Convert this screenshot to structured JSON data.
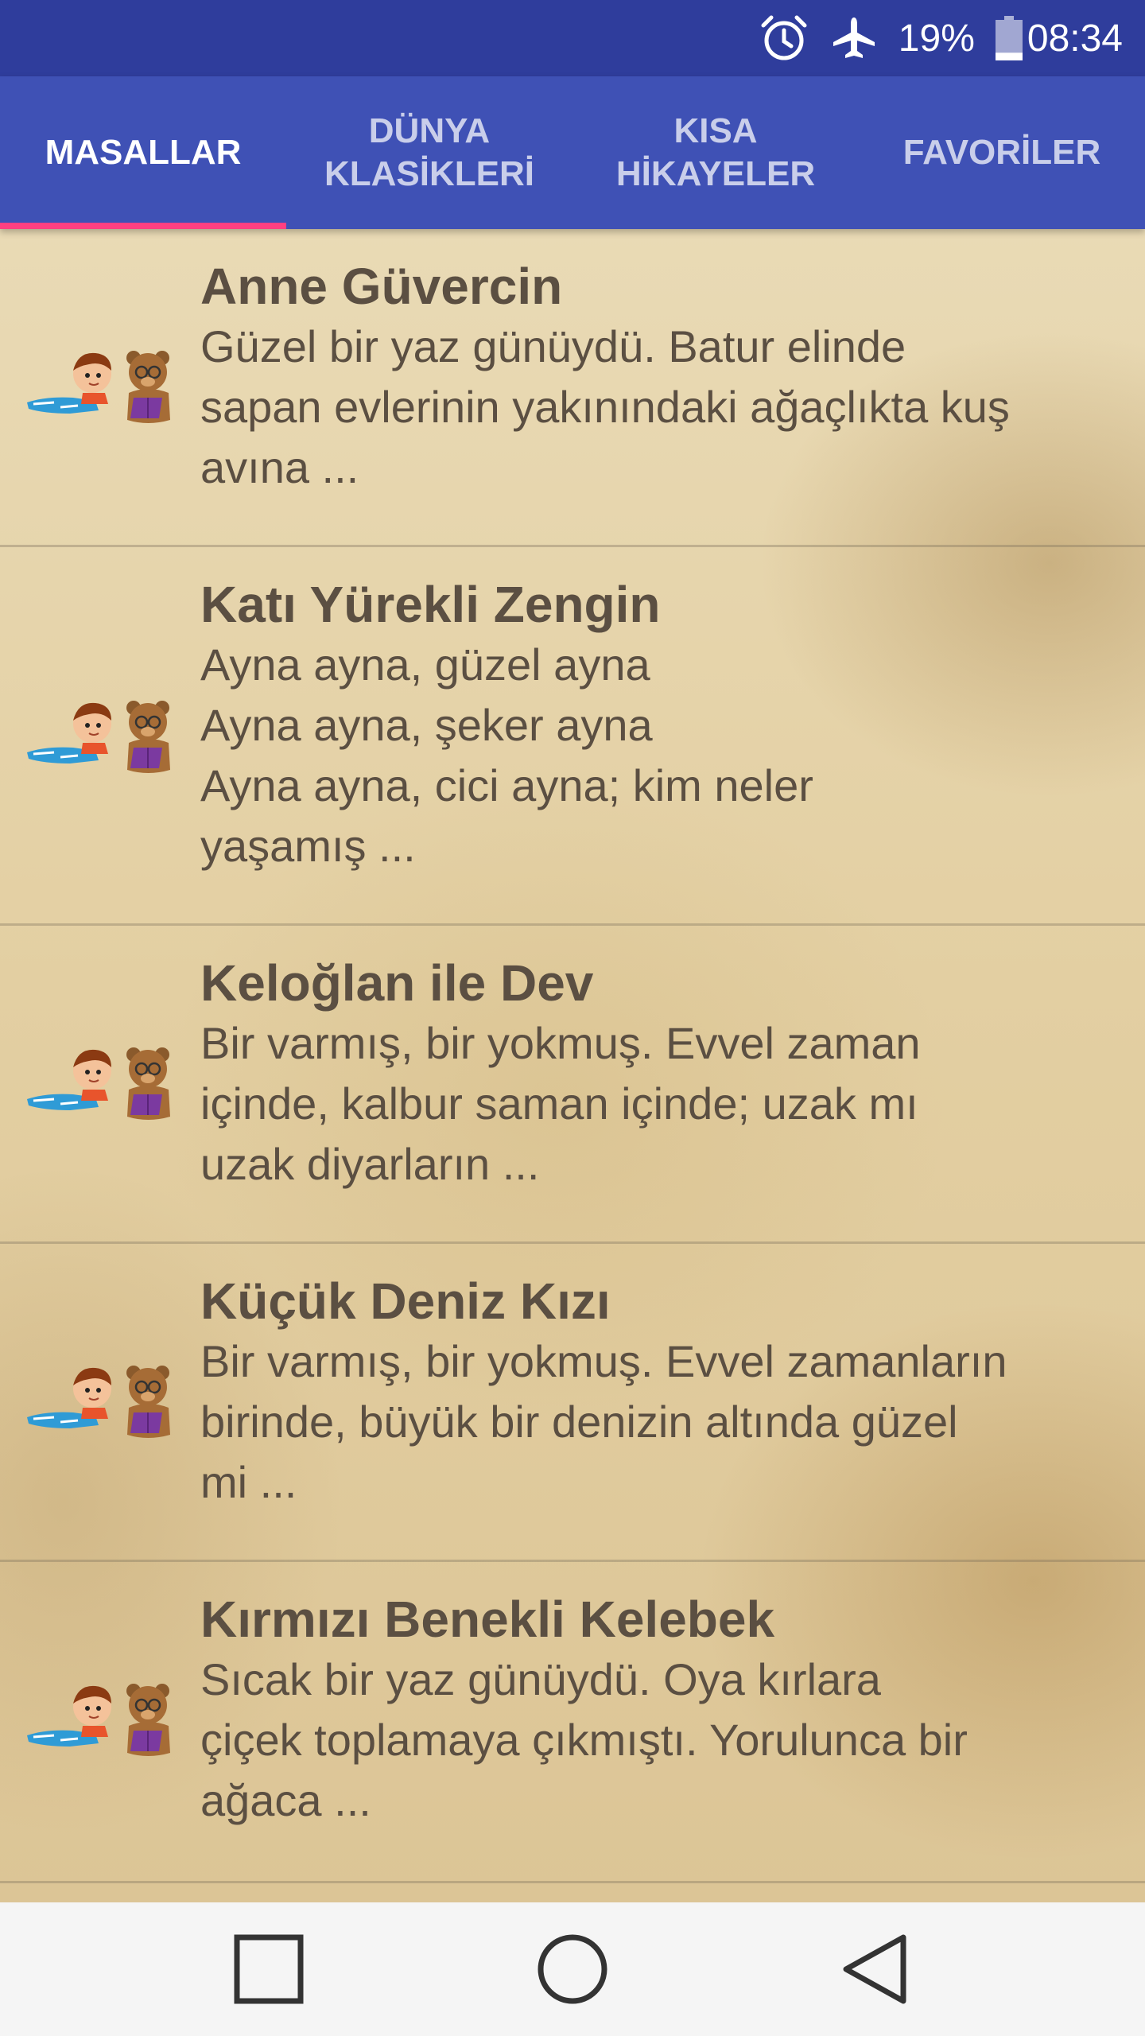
{
  "status_bar": {
    "battery": "19%",
    "time": "08:34",
    "icons": [
      "alarm-icon",
      "airplane-icon",
      "battery-icon"
    ],
    "battery_level": 0.19
  },
  "tabs": [
    {
      "label": "MASALLAR",
      "active": true
    },
    {
      "label": "DÜNYA\nKLASİKLERİ",
      "active": false
    },
    {
      "label": "KISA\nHİKAYELER",
      "active": false
    },
    {
      "label": "FAVORİLER",
      "active": false
    }
  ],
  "stories": [
    {
      "title": "Anne Güvercin",
      "excerpt": "Güzel bir yaz günüydü. Batur elinde\nsapan evlerinin yakınındaki ağaçlıkta kuş\navına ..."
    },
    {
      "title": "Katı Yürekli Zengin",
      "excerpt": "Ayna ayna, güzel ayna\nAyna ayna, şeker ayna\nAyna ayna, cici ayna; kim neler\nyaşamış ..."
    },
    {
      "title": "Keloğlan ile Dev",
      "excerpt": "Bir varmış, bir yokmuş. Evvel zaman\niçinde, kalbur saman içinde; uzak mı\nuzak diyarların ..."
    },
    {
      "title": "Küçük Deniz Kızı",
      "excerpt": "Bir varmış, bir yokmuş. Evvel zamanların\nbirinde, büyük bir denizin altında güzel\nmi ..."
    },
    {
      "title": "Kırmızı Benekli Kelebek",
      "excerpt": "Sıcak bir yaz günüydü. Oya kırlara\nçiçek toplamaya çıkmıştı. Yorulunca bir\nağaca ..."
    }
  ],
  "colors": {
    "status_bar": "#2f3d9c",
    "tab_bar": "#3f51b5",
    "tab_indicator": "#ff4081",
    "text": "#5b4f42"
  },
  "nav_bar": {
    "icons": [
      "recents-square-icon",
      "home-circle-icon",
      "back-triangle-icon"
    ]
  }
}
